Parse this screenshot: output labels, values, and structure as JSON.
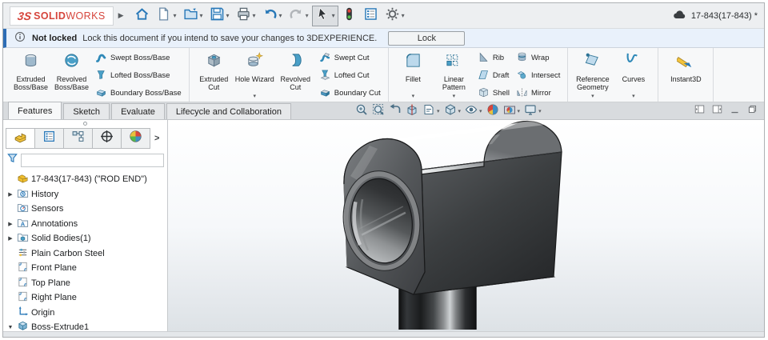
{
  "colors": {
    "brand_red": "#d6453c",
    "accent_blue": "#2878b8",
    "notification_bg": "#e9f1fb",
    "notification_accent": "#2d6db5",
    "ribbon_bg": "#f7f8f9",
    "tabstrip_bg": "#d8dbde",
    "viewport_gradient_bottom": "#dde2e6",
    "model_gray": "#4a4d50"
  },
  "titlebar": {
    "logo": {
      "mark": "3S",
      "bold": "SOLID",
      "light": "WORKS"
    },
    "document": "17-843(17-843) *",
    "tools": [
      {
        "icon": "home-icon"
      },
      {
        "icon": "new-document-icon",
        "dd": true
      },
      {
        "icon": "open-document-icon",
        "dd": true
      },
      {
        "icon": "save-icon",
        "dd": true
      },
      {
        "icon": "print-icon",
        "dd": true
      },
      {
        "icon": "undo-icon",
        "dd": true
      },
      {
        "icon": "redo-icon",
        "dd": true,
        "disabled": true
      },
      {
        "icon": "select-cursor-icon",
        "dd": true,
        "pressed": true
      },
      {
        "icon": "status-light-icon"
      },
      {
        "icon": "document-properties-icon"
      },
      {
        "icon": "options-gear-icon",
        "dd": true
      }
    ]
  },
  "notification": {
    "title": "Not locked",
    "message": "Lock this document if you intend to save your changes to 3DEXPERIENCE.",
    "action": "Lock"
  },
  "ribbon": {
    "groups": [
      {
        "big": [
          {
            "icon": "extruded-boss",
            "label": "Extruded Boss/Base"
          },
          {
            "icon": "revolved-boss",
            "label": "Revolved Boss/Base"
          }
        ],
        "stacks": [
          [
            {
              "icon": "swept-boss",
              "label": "Swept Boss/Base"
            },
            {
              "icon": "lofted-boss",
              "label": "Lofted Boss/Base"
            },
            {
              "icon": "boundary-boss",
              "label": "Boundary Boss/Base"
            }
          ]
        ]
      },
      {
        "big": [
          {
            "icon": "extruded-cut",
            "label": "Extruded Cut"
          },
          {
            "icon": "hole-wizard",
            "label": "Hole Wizard",
            "dd": true
          },
          {
            "icon": "revolved-cut",
            "label": "Revolved Cut"
          }
        ],
        "stacks": [
          [
            {
              "icon": "swept-cut",
              "label": "Swept Cut"
            },
            {
              "icon": "lofted-cut",
              "label": "Lofted Cut"
            },
            {
              "icon": "boundary-cut",
              "label": "Boundary Cut"
            }
          ]
        ]
      },
      {
        "big": [
          {
            "icon": "fillet",
            "label": "Fillet",
            "dd": true
          },
          {
            "icon": "linear-pattern",
            "label": "Linear Pattern",
            "dd": true
          }
        ],
        "stacks": [
          [
            {
              "icon": "rib",
              "label": "Rib"
            },
            {
              "icon": "draft",
              "label": "Draft"
            },
            {
              "icon": "shell",
              "label": "Shell"
            }
          ],
          [
            {
              "icon": "wrap",
              "label": "Wrap"
            },
            {
              "icon": "intersect",
              "label": "Intersect"
            },
            {
              "icon": "mirror",
              "label": "Mirror"
            }
          ]
        ]
      },
      {
        "big": [
          {
            "icon": "reference-geometry",
            "label": "Reference Geometry",
            "dd": true
          },
          {
            "icon": "curves",
            "label": "Curves",
            "dd": true
          }
        ],
        "stacks": []
      },
      {
        "big": [
          {
            "icon": "instant3d",
            "label": "Instant3D",
            "wide": true
          }
        ],
        "stacks": []
      }
    ]
  },
  "command_tabs": {
    "items": [
      "Features",
      "Sketch",
      "Evaluate",
      "Lifecycle and Collaboration"
    ],
    "active": "Features"
  },
  "headsup": {
    "items": [
      {
        "icon": "zoom-fit-icon"
      },
      {
        "icon": "zoom-area-icon"
      },
      {
        "icon": "previous-view-icon"
      },
      {
        "icon": "section-view-icon"
      },
      {
        "icon": "annotation-views-icon",
        "dd": true
      },
      {
        "icon": "view-orientation-icon",
        "dd": true
      },
      {
        "icon": "hide-show-items-icon",
        "dd": true
      },
      {
        "icon": "edit-appearance-icon"
      },
      {
        "icon": "apply-scene-icon",
        "dd": true
      },
      {
        "icon": "view-settings-icon",
        "dd": true
      }
    ]
  },
  "window_controls": [
    {
      "icon": "pane-left-icon"
    },
    {
      "icon": "pane-right-icon"
    },
    {
      "icon": "minimize-icon"
    },
    {
      "icon": "restore-icon"
    }
  ],
  "feature_panel": {
    "tabs": [
      {
        "icon": "featuremanager-icon",
        "active": true
      },
      {
        "icon": "propertymanager-icon"
      },
      {
        "icon": "configurationmanager-icon"
      },
      {
        "icon": "dimxpertmanager-icon"
      },
      {
        "icon": "displaymanager-icon"
      }
    ],
    "chevron": ">",
    "filter_value": "",
    "tree": {
      "root": {
        "icon": "part-icon",
        "label": "17-843(17-843) (\"ROD END\")"
      },
      "items": [
        {
          "arrow": "collapsed",
          "icon": "history-folder-icon",
          "label": "History"
        },
        {
          "arrow": "none",
          "icon": "sensors-folder-icon",
          "label": "Sensors"
        },
        {
          "arrow": "collapsed",
          "icon": "annotations-folder-icon",
          "label": "Annotations"
        },
        {
          "arrow": "collapsed",
          "icon": "solid-bodies-folder-icon",
          "label": "Solid Bodies(1)"
        },
        {
          "arrow": "none",
          "icon": "material-icon",
          "label": "Plain Carbon Steel"
        },
        {
          "arrow": "none",
          "icon": "plane-icon",
          "label": "Front Plane"
        },
        {
          "arrow": "none",
          "icon": "plane-icon",
          "label": "Top Plane"
        },
        {
          "arrow": "none",
          "icon": "plane-icon",
          "label": "Right Plane"
        },
        {
          "arrow": "none",
          "icon": "origin-icon",
          "label": "Origin"
        },
        {
          "arrow": "expanded",
          "icon": "boss-extrude-icon",
          "label": "Boss-Extrude1"
        }
      ]
    }
  }
}
